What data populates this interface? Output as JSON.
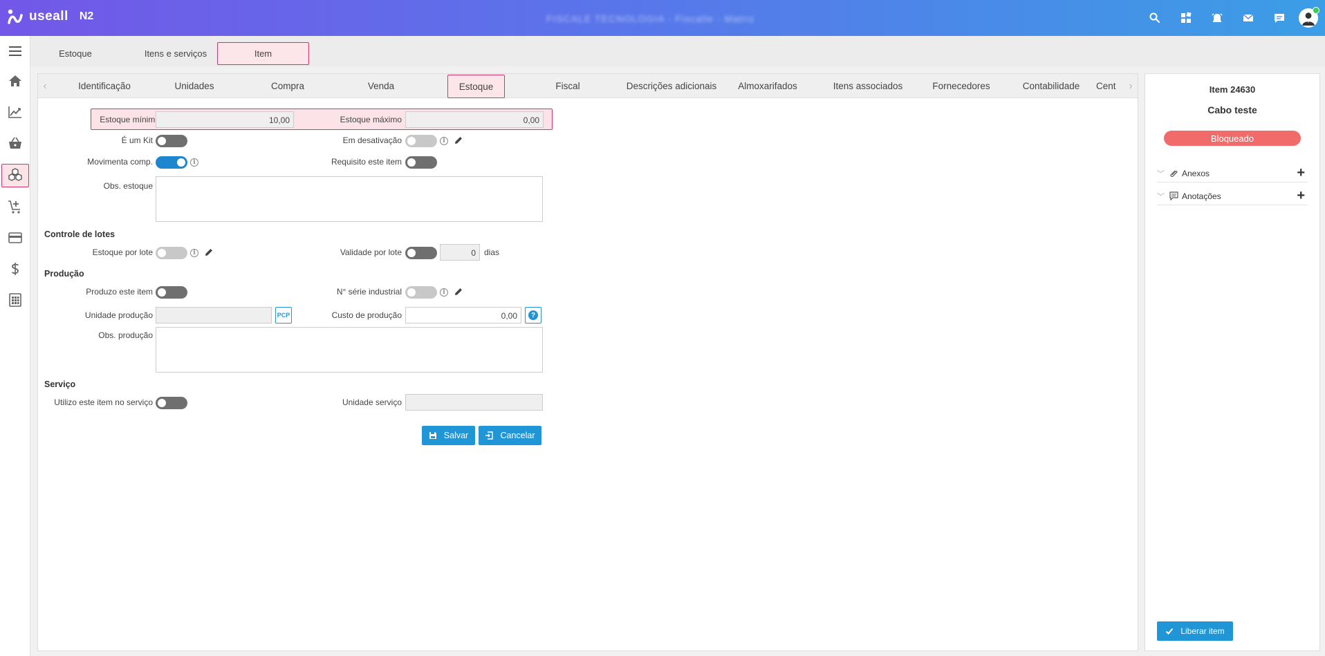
{
  "app": {
    "brand": "useall",
    "version": "N2",
    "company": "FISCALE TECNOLOGIA - Fiscalle - Matriz"
  },
  "module_tabs": [
    {
      "label": "Estoque"
    },
    {
      "label": "Itens e serviços"
    },
    {
      "label": "Item"
    }
  ],
  "sub_tabs": [
    {
      "label": "Identificação"
    },
    {
      "label": "Unidades"
    },
    {
      "label": "Compra"
    },
    {
      "label": "Venda"
    },
    {
      "label": "Estoque"
    },
    {
      "label": "Fiscal"
    },
    {
      "label": "Descrições adicionais"
    },
    {
      "label": "Almoxarifados"
    },
    {
      "label": "Itens associados"
    },
    {
      "label": "Fornecedores"
    },
    {
      "label": "Contabilidade"
    },
    {
      "label": "Cent"
    }
  ],
  "form": {
    "estoque_minimo_label": "Estoque mínimo",
    "estoque_minimo_value": "10,00",
    "estoque_maximo_label": "Estoque máximo",
    "estoque_maximo_value": "0,00",
    "kit_label": "É um Kit",
    "desativacao_label": "Em desativação",
    "movimenta_label": "Movimenta comp.",
    "requisito_label": "Requisito este item",
    "obs_estoque_label": "Obs. estoque",
    "lotes_section": "Controle de lotes",
    "estoque_lote_label": "Estoque por lote",
    "validade_lote_label": "Validade por lote",
    "validade_dias_value": "0",
    "dias_label": "dias",
    "producao_section": "Produção",
    "produzo_label": "Produzo este item",
    "serie_label": "N° série industrial",
    "unidade_producao_label": "Unidade produção",
    "pcp_label": "PCP",
    "custo_producao_label": "Custo de produção",
    "custo_producao_value": "0,00",
    "help_label": "?",
    "obs_producao_label": "Obs. produção",
    "servico_section": "Serviço",
    "utilizo_label": "Utilizo este item no serviço",
    "unidade_servico_label": "Unidade serviço",
    "salvar_label": "Salvar",
    "cancelar_label": "Cancelar",
    "info_glyph": "i"
  },
  "toggles": {
    "kit": false,
    "desativacao": false,
    "movimenta": true,
    "requisito": false,
    "estoque_lote": false,
    "validade_lote": false,
    "produzo": false,
    "serie": false,
    "utilizo": false
  },
  "right_panel": {
    "item_number": "Item 24630",
    "item_name": "Cabo teste",
    "status": "Bloqueado",
    "anexos_label": "Anexos",
    "anotacoes_label": "Anotações",
    "plus_glyph": "+",
    "chev_glyph": "﹀",
    "liberar_label": "Liberar item"
  },
  "colors": {
    "accent": "#2196d6",
    "highlight_border": "#d6336c",
    "status_blocked": "#f26b6b",
    "gradient_start": "#7357e8",
    "gradient_end": "#3b9ee6"
  }
}
